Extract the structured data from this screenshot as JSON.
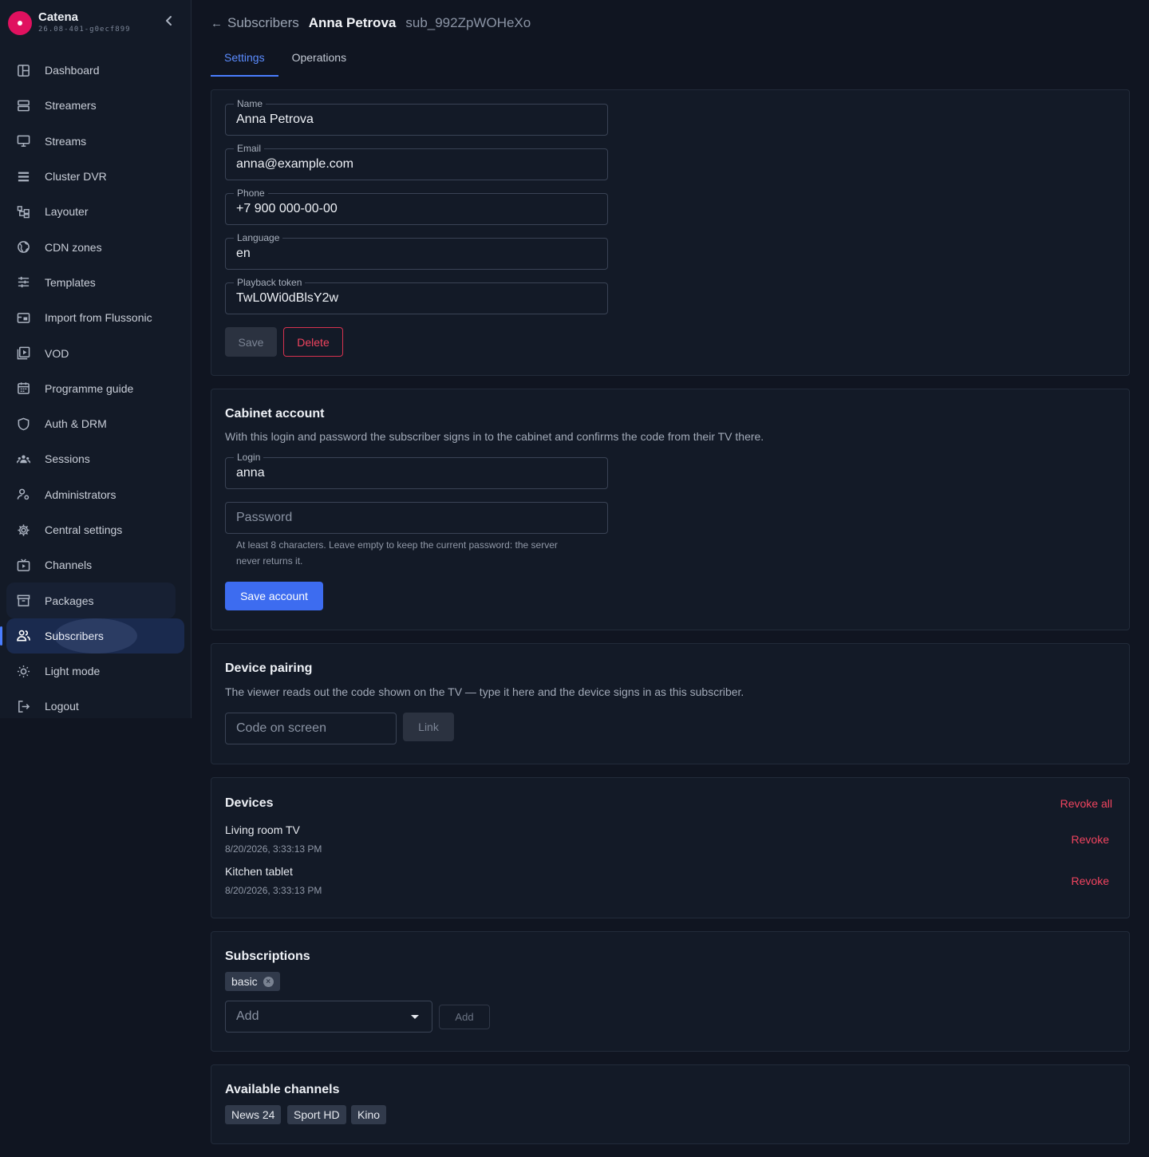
{
  "app": {
    "name": "Catena",
    "version": "26.08-401-g0ecf899"
  },
  "sidebar": {
    "items": [
      {
        "label": "Dashboard",
        "icon": "dashboard-icon"
      },
      {
        "label": "Streamers",
        "icon": "server-icon"
      },
      {
        "label": "Streams",
        "icon": "monitor-icon"
      },
      {
        "label": "Cluster DVR",
        "icon": "storage-icon"
      },
      {
        "label": "Layouter",
        "icon": "layout-icon"
      },
      {
        "label": "CDN zones",
        "icon": "globe-icon"
      },
      {
        "label": "Templates",
        "icon": "sliders-icon"
      },
      {
        "label": "Import from Flussonic",
        "icon": "import-icon"
      },
      {
        "label": "VOD",
        "icon": "video-library-icon"
      },
      {
        "label": "Programme guide",
        "icon": "calendar-icon"
      },
      {
        "label": "Auth & DRM",
        "icon": "shield-icon"
      },
      {
        "label": "Sessions",
        "icon": "group-icon"
      },
      {
        "label": "Administrators",
        "icon": "user-cog-icon"
      },
      {
        "label": "Central settings",
        "icon": "gear-icon"
      },
      {
        "label": "Channels",
        "icon": "tv-icon"
      },
      {
        "label": "Packages",
        "icon": "archive-icon"
      },
      {
        "label": "Subscribers",
        "icon": "users-icon",
        "active": true
      },
      {
        "label": "Light mode",
        "icon": "sun-icon"
      },
      {
        "label": "Logout",
        "icon": "logout-icon"
      }
    ]
  },
  "header": {
    "back_label": "Subscribers",
    "subscriber_name": "Anna Petrova",
    "subscriber_id": "sub_992ZpWOHeXo"
  },
  "tabs": [
    {
      "label": "Settings",
      "active": true
    },
    {
      "label": "Operations",
      "active": false
    }
  ],
  "profile": {
    "fields": [
      {
        "label": "Name",
        "value": "Anna Petrova"
      },
      {
        "label": "Email",
        "value": "anna@example.com"
      },
      {
        "label": "Phone",
        "value": "+7 900 000-00-00"
      },
      {
        "label": "Language",
        "value": "en"
      },
      {
        "label": "Playback token",
        "value": "TwL0Wi0dBlsY2w"
      }
    ],
    "save_label": "Save",
    "delete_label": "Delete"
  },
  "cabinet": {
    "title": "Cabinet account",
    "description": "With this login and password the subscriber signs in to the cabinet and confirms the code from their TV there.",
    "login_label": "Login",
    "login_value": "anna",
    "password_placeholder": "Password",
    "password_help_line1": "At least 8 characters. Leave empty to keep the current password: the server",
    "password_help_line2": "never returns it.",
    "save_label": "Save account"
  },
  "pairing": {
    "title": "Device pairing",
    "description": "The viewer reads out the code shown on the TV — type it here and the device signs in as this subscriber.",
    "code_placeholder": "Code on screen",
    "link_label": "Link"
  },
  "devices": {
    "title": "Devices",
    "revoke_all_label": "Revoke all",
    "revoke_label": "Revoke",
    "items": [
      {
        "name": "Living room TV",
        "time": "8/20/2026, 3:33:13 PM"
      },
      {
        "name": "Kitchen tablet",
        "time": "8/20/2026, 3:33:13 PM"
      }
    ]
  },
  "subscriptions": {
    "title": "Subscriptions",
    "chips": [
      "basic"
    ],
    "select_placeholder": "Add",
    "add_label": "Add"
  },
  "channels": {
    "title": "Available channels",
    "items": [
      "News 24",
      "Sport HD",
      "Kino"
    ]
  },
  "colors": {
    "background": "#101521",
    "card": "#131a27",
    "accent": "#3d6cf0",
    "danger": "#f0445f",
    "brand": "#e0115f"
  }
}
